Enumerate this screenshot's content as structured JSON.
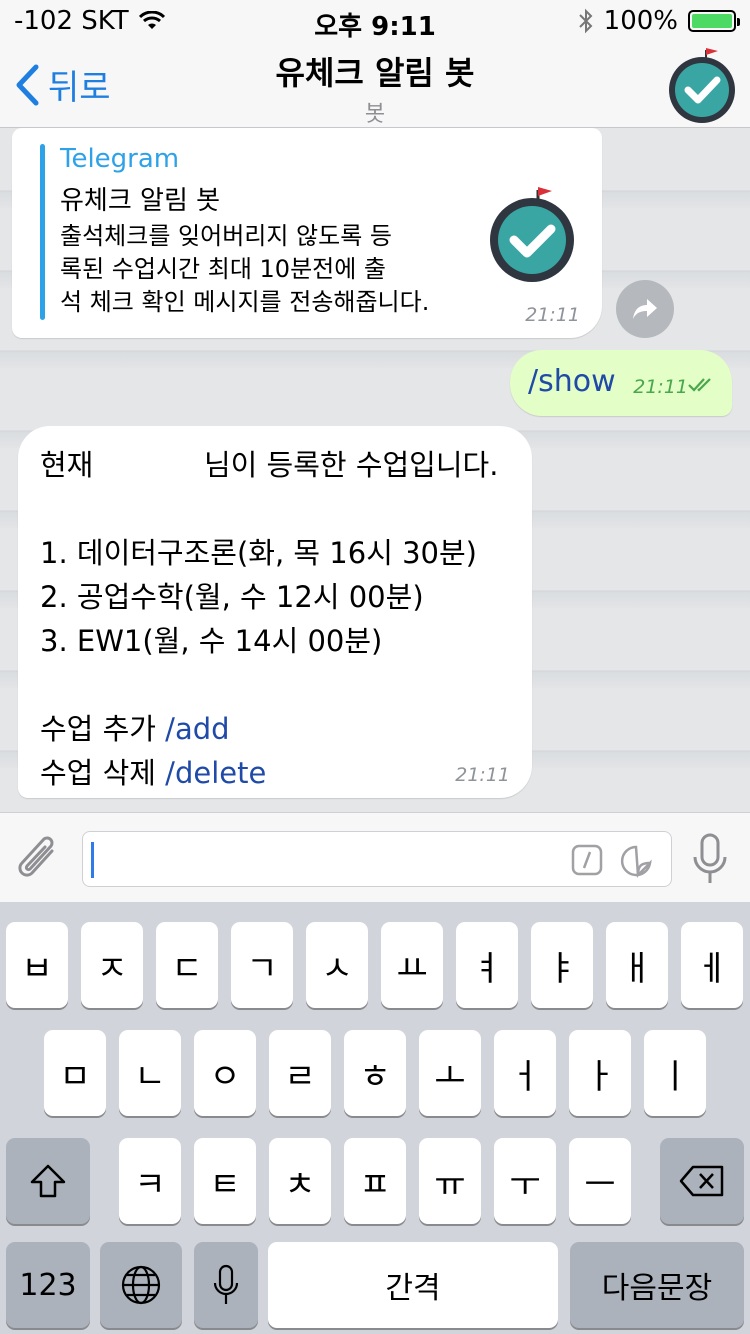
{
  "status_bar": {
    "carrier": "-102 SKT",
    "time": "오후 9:11",
    "battery": "100%",
    "battery_level": 1.0
  },
  "nav": {
    "back_label": "뒤로",
    "title": "유체크 알림 봇",
    "subtitle": "봇"
  },
  "messages": {
    "preview": {
      "site": "Telegram",
      "title": "유체크 알림 봇",
      "desc_lines": [
        "출석체크를 잊어버리지 않도록 등",
        "록된 수업시간 최대 10분전에 출",
        "석 체크 확인 메시지를 전송해줍니다."
      ],
      "time": "21:11"
    },
    "outgoing": {
      "text": "/show",
      "time": "21:11"
    },
    "reply": {
      "line1": "현재            님이 등록한 수업입니다.",
      "item1": "1. 데이터구조론(화, 목 16시 30분)",
      "item2": "2. 공업수학(월, 수 12시 00분)",
      "item3": "3. EW1(월, 수 14시 00분)",
      "add_label": "수업 추가 ",
      "add_cmd": "/add",
      "delete_label": "수업 삭제 ",
      "delete_cmd": "/delete",
      "time": "21:11"
    }
  },
  "keyboard": {
    "row1": [
      "ㅂ",
      "ㅈ",
      "ㄷ",
      "ㄱ",
      "ㅅ",
      "ㅛ",
      "ㅕ",
      "ㅑ",
      "ㅐ",
      "ㅔ"
    ],
    "row2": [
      "ㅁ",
      "ㄴ",
      "ㅇ",
      "ㄹ",
      "ㅎ",
      "ㅗ",
      "ㅓ",
      "ㅏ",
      "ㅣ"
    ],
    "row3": [
      "ㅋ",
      "ㅌ",
      "ㅊ",
      "ㅍ",
      "ㅠ",
      "ㅜ",
      "ㅡ"
    ],
    "numbers": "123",
    "space": "간격",
    "return": "다음문장"
  },
  "colors": {
    "accent": "#1f7fe0",
    "link": "#1f4aa8",
    "outgoing_bubble": "#e3fec6",
    "read_check": "#4aa74d",
    "battery": "#4cd964"
  },
  "icons": [
    "wifi-icon",
    "bluetooth-icon",
    "chevron-left-icon",
    "checkmark-badge-icon",
    "share-icon",
    "double-check-icon",
    "paperclip-icon",
    "slash-command-icon",
    "sticker-icon",
    "microphone-icon",
    "shift-icon",
    "backspace-icon",
    "globe-icon"
  ]
}
